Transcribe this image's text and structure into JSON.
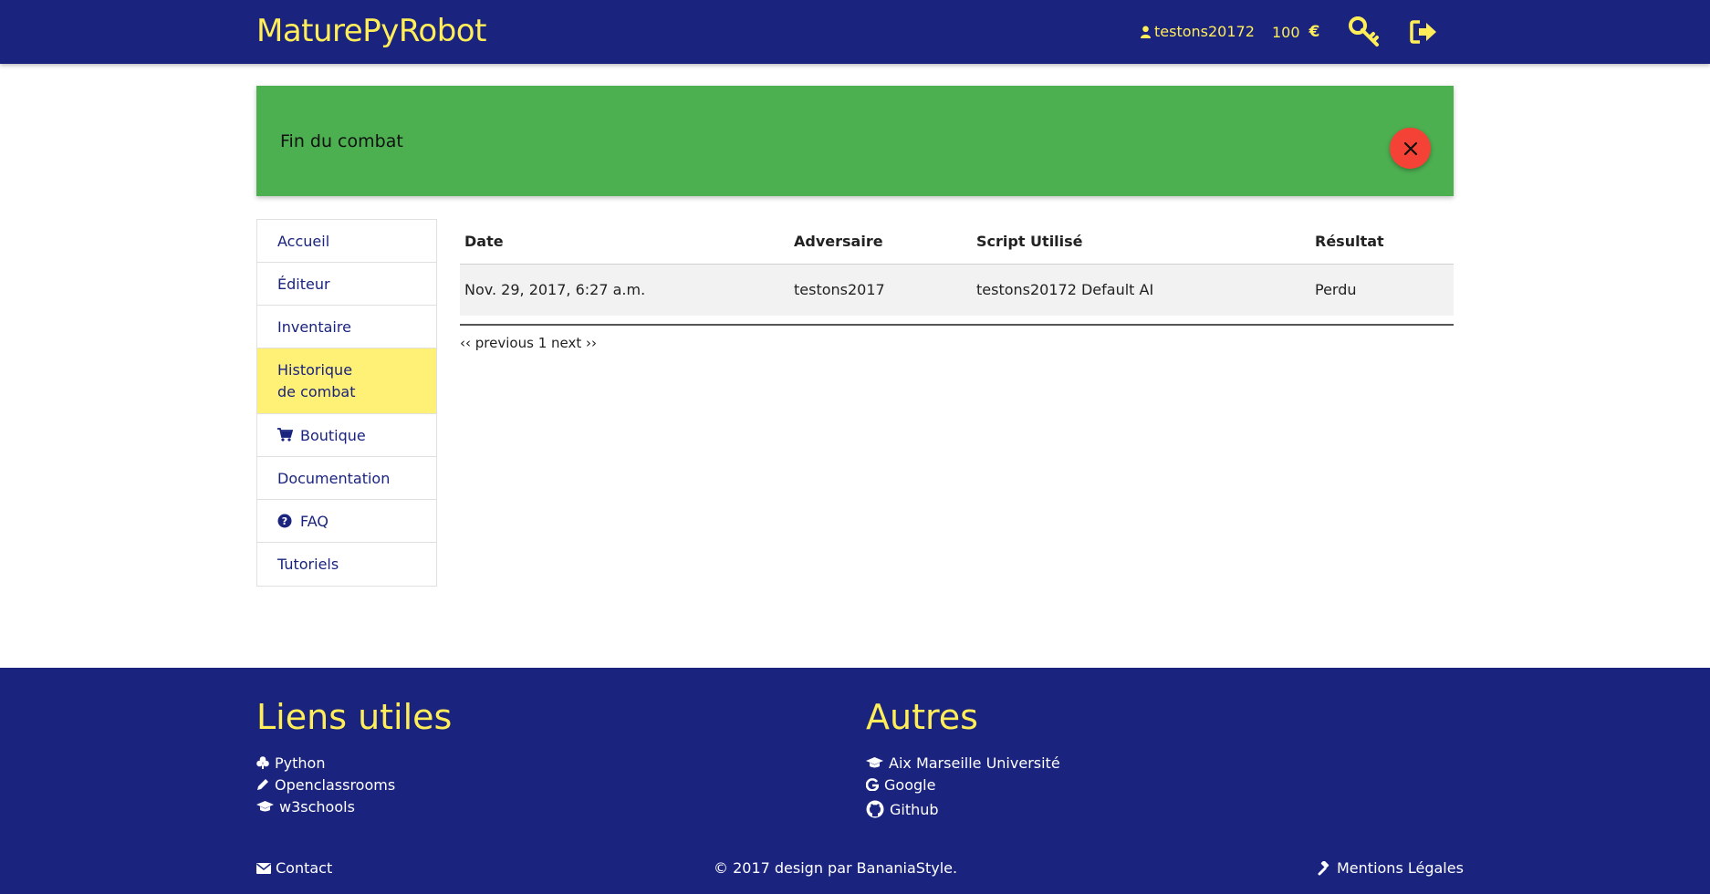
{
  "navbar": {
    "brand": "MaturePyRobot",
    "username": "testons20172",
    "money": "100",
    "currency": "€"
  },
  "alert": {
    "message": "Fin du combat"
  },
  "sidebar": {
    "items": [
      {
        "label": "Accueil",
        "icon": ""
      },
      {
        "label": "Éditeur",
        "icon": ""
      },
      {
        "label": "Inventaire",
        "icon": ""
      },
      {
        "label": "Historique\nde combat",
        "icon": "",
        "active": true
      },
      {
        "label": "Boutique",
        "icon": "cart-icon"
      },
      {
        "label": "Documentation",
        "icon": ""
      },
      {
        "label": "FAQ",
        "icon": "question-circle-icon"
      },
      {
        "label": "Tutoriels",
        "icon": ""
      }
    ]
  },
  "table": {
    "headers": [
      "Date",
      "Adversaire",
      "Script Utilisé",
      "Résultat"
    ],
    "rows": [
      [
        "Nov. 29, 2017, 6:27 a.m.",
        "testons2017",
        "testons20172 Default AI",
        "Perdu"
      ]
    ]
  },
  "pager": {
    "previous": "‹‹ previous",
    "page": "1",
    "next": "next ››"
  },
  "footer": {
    "useful_title": "Liens utiles",
    "useful_links": [
      {
        "label": "Python",
        "icon": "python-icon"
      },
      {
        "label": "Openclassrooms",
        "icon": "pencil-icon"
      },
      {
        "label": "w3schools",
        "icon": "graduation-cap-icon"
      }
    ],
    "others_title": "Autres",
    "others_links": [
      {
        "label": "Aix Marseille Université",
        "icon": "graduation-cap-icon"
      },
      {
        "label": "Google",
        "icon": "google-icon"
      },
      {
        "label": "Github",
        "icon": "github-icon"
      }
    ],
    "contact": "Contact",
    "copyright": "© 2017 design par BananiaStyle.",
    "legal": "Mentions Légales"
  },
  "colors": {
    "primary": "#1a237e",
    "accent": "#ffee58",
    "alert_bg": "#4caf50",
    "close_btn": "#f44336",
    "active_item": "#fff176"
  }
}
